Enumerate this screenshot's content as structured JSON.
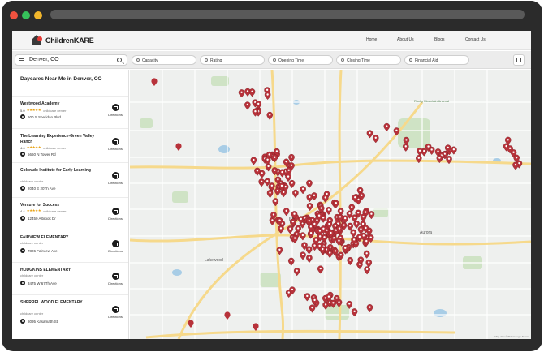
{
  "app": {
    "brand": "ChildrenKARE"
  },
  "nav": {
    "home": "Home",
    "about": "About Us",
    "blogs": "Blogs",
    "contact": "Contact Us"
  },
  "search": {
    "value": "Denver, CO"
  },
  "filters": [
    "Capacity",
    "Rating",
    "Opening Time",
    "Closing Time",
    "Financial Aid"
  ],
  "sidebar": {
    "title": "Daycares Near Me in Denver, CO",
    "directions_label": "Directions",
    "listings": [
      {
        "name": "Westwood Academy",
        "rating": "5.0",
        "stars": "★★★★★",
        "type": "childcare center",
        "address": "600 S Sheridan Blvd"
      },
      {
        "name": "The Learning Experience-Green Valley Ranch",
        "rating": "4.6",
        "stars": "★★★★★",
        "type": "childcare center",
        "address": "5660 N Tower Rd"
      },
      {
        "name": "Colorado Institute for Early Learning",
        "rating": "",
        "stars": "",
        "type": "childcare center",
        "address": "2040 E 20Th Ave"
      },
      {
        "name": "Venture for Success",
        "rating": "4.4",
        "stars": "★★★★★",
        "type": "childcare center",
        "address": "12450 Albrook Dr"
      },
      {
        "name": "FAIRVIEW ELEMENTARY",
        "rating": "",
        "stars": "",
        "type": "childcare center",
        "address": "7826 Fairview Ave"
      },
      {
        "name": "HODGKINS ELEMENTARY",
        "rating": "",
        "stars": "",
        "type": "childcare center",
        "address": "3475 W 67Th Ave"
      },
      {
        "name": "SHERREL WOOD ELEMENTARY",
        "rating": "",
        "stars": "",
        "type": "childcare center",
        "address": "8095 Kasamath St"
      }
    ]
  },
  "map": {
    "labels": {
      "city": "Denver",
      "aurora": "Aurora",
      "lakewood": "Lakewood",
      "arsenal": "Rocky Mountain Arsenal",
      "footer": "Map data ©2024 Google  Terms"
    },
    "marker_color": "#b7323a",
    "colors": {
      "park": "#cfe3c5",
      "water": "#a8cde6",
      "highway": "#f6d98b",
      "road": "#ffffff"
    }
  }
}
